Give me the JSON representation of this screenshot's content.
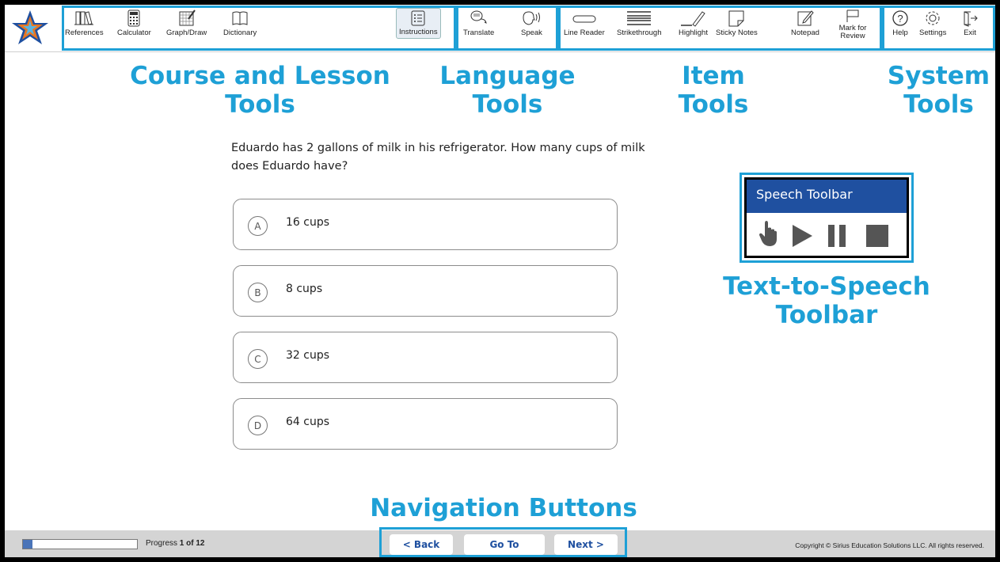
{
  "toolbar": {
    "course_tools": [
      {
        "label": "References",
        "icon": "references-icon"
      },
      {
        "label": "Calculator",
        "icon": "calculator-icon"
      },
      {
        "label": "Graph/Draw",
        "icon": "graph-draw-icon"
      },
      {
        "label": "Dictionary",
        "icon": "dictionary-icon"
      }
    ],
    "instructions": {
      "label": "Instructions",
      "icon": "instructions-icon"
    },
    "language_tools": [
      {
        "label": "Translate",
        "icon": "translate-icon"
      },
      {
        "label": "Speak",
        "icon": "speak-icon"
      }
    ],
    "item_tools": [
      {
        "label": "Line Reader",
        "icon": "line-reader-icon"
      },
      {
        "label": "Strikethrough",
        "icon": "strikethrough-icon"
      },
      {
        "label": "Highlight",
        "icon": "highlight-icon"
      },
      {
        "label": "Sticky Notes",
        "icon": "sticky-notes-icon"
      },
      {
        "label": "Notepad",
        "icon": "notepad-icon"
      },
      {
        "label": "Mark for Review",
        "icon": "flag-icon"
      }
    ],
    "system_tools": [
      {
        "label": "Help",
        "icon": "help-icon"
      },
      {
        "label": "Settings",
        "icon": "gear-icon"
      },
      {
        "label": "Exit",
        "icon": "exit-icon"
      }
    ]
  },
  "annotations": {
    "course": "Course and Lesson Tools",
    "course_line1": "Course and Lesson",
    "course_line2": "Tools",
    "language_line1": "Language",
    "language_line2": "Tools",
    "item_line1": "Item",
    "item_line2": "Tools",
    "system_line1": "System",
    "system_line2": "Tools",
    "tts_line1": "Text-to-Speech",
    "tts_line2": "Toolbar",
    "nav": "Navigation Buttons"
  },
  "question": {
    "text": "Eduardo has 2 gallons of milk in his refrigerator. How many cups of milk does Eduardo have?",
    "answers": [
      {
        "letter": "A",
        "text": "16 cups"
      },
      {
        "letter": "B",
        "text": "8 cups"
      },
      {
        "letter": "C",
        "text": "32 cups"
      },
      {
        "letter": "D",
        "text": "64 cups"
      }
    ]
  },
  "speech_toolbar": {
    "title": "Speech Toolbar",
    "controls": [
      "pointer-icon",
      "play-icon",
      "pause-icon",
      "stop-icon"
    ]
  },
  "footer": {
    "progress_label": "Progress",
    "progress_value": "1 of 12",
    "progress_fraction": 0.083,
    "back": "< Back",
    "goto": "Go To",
    "next": "Next >",
    "copyright": "Copyright © Sirius Education Solutions LLC. All rights reserved."
  },
  "colors": {
    "accent": "#1ea0d6",
    "brand_blue": "#1f50a0"
  }
}
